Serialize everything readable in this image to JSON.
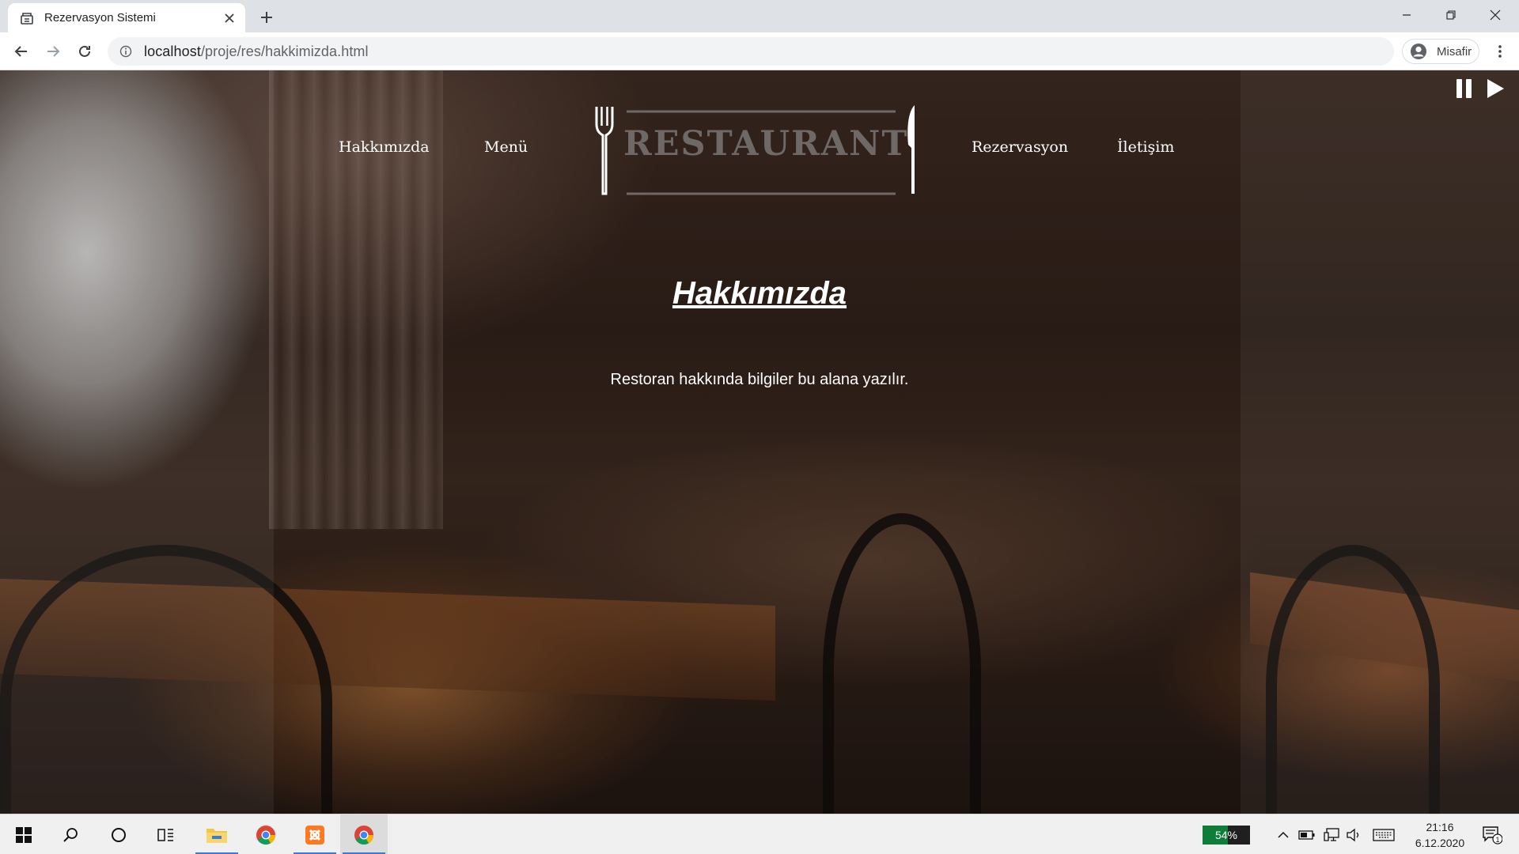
{
  "browser": {
    "tab_title": "Rezervasyon Sistemi",
    "url_host": "localhost",
    "url_path": "/proje/res/hakkimizda.html",
    "profile_label": "Misafir"
  },
  "site": {
    "nav": {
      "about": "Hakkımızda",
      "menu": "Menü",
      "reservation": "Rezervasyon",
      "contact": "İletişim"
    },
    "logo_text": "RESTAURANT",
    "page_title": "Hakkımızda",
    "page_text": "Restoran hakkında bilgiler bu alana yazılır."
  },
  "taskbar": {
    "battery_badge": "54%",
    "battery_level": 0.54,
    "time": "21:16",
    "date": "6.12.2020",
    "notification_count": "1"
  },
  "colors": {
    "logo_text": "#6e6867",
    "active_indicator": "#3a7bd5",
    "battery_fill": "#0e7d3a"
  },
  "icons": [
    "restaurant-favicon-icon",
    "close-icon",
    "plus-icon",
    "minimize-icon",
    "maximize-icon",
    "back-icon",
    "forward-icon",
    "reload-icon",
    "info-icon",
    "avatar-icon",
    "more-vert-icon",
    "pause-icon",
    "play-icon",
    "fork-icon",
    "knife-icon",
    "windows-icon",
    "search-icon",
    "cortana-icon",
    "task-view-icon",
    "file-explorer-icon",
    "chrome-icon",
    "xampp-icon",
    "chevron-up-icon",
    "battery-icon",
    "network-icon",
    "volume-icon",
    "keyboard-icon",
    "notification-icon"
  ]
}
